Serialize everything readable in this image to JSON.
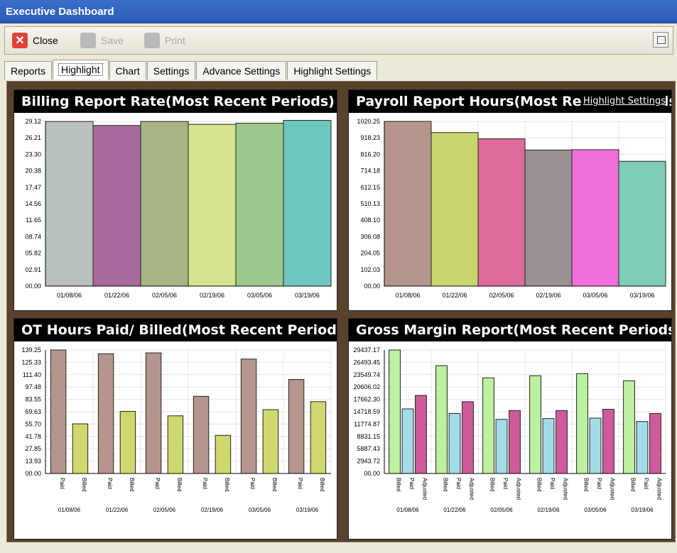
{
  "window": {
    "title": "Executive Dashboard"
  },
  "toolbar": {
    "close_label": "Close",
    "save_label": "Save",
    "print_label": "Print",
    "icons": {
      "close": "close-icon",
      "save": "save-icon",
      "print": "print-icon",
      "restore": "restore-window-icon"
    }
  },
  "tabs": [
    {
      "label": "Reports",
      "active": false
    },
    {
      "label": "Highlight",
      "active": true
    },
    {
      "label": "Chart",
      "active": false
    },
    {
      "label": "Settings",
      "active": false
    },
    {
      "label": "Advance Settings",
      "active": false
    },
    {
      "label": "Highlight Settings",
      "active": false
    }
  ],
  "highlight_link": "Highlight Settings",
  "colors": {
    "panel_bg": "#59412c",
    "title_bg": "#000000"
  },
  "chart_data": [
    {
      "type": "bar",
      "title": "Billing Report Rate(Most Recent Periods)",
      "categories": [
        "01/08/06",
        "01/22/06",
        "02/05/06",
        "02/19/06",
        "03/05/06",
        "03/19/06"
      ],
      "values": [
        29.1,
        28.4,
        29.1,
        28.6,
        28.8,
        29.3
      ],
      "yticks": [
        "00.00",
        "02.91",
        "05.82",
        "08.74",
        "11.65",
        "14.56",
        "17.47",
        "20.38",
        "23.30",
        "26.21",
        "29.12"
      ],
      "ylim": [
        0,
        29.12
      ],
      "colors": [
        "#b9c1be",
        "#a8699c",
        "#a6b582",
        "#d3e48c",
        "#9cc88c",
        "#6ec7bf"
      ],
      "grid": true
    },
    {
      "type": "bar",
      "title": "Payroll Report Hours(Most Recent Periods)",
      "categories": [
        "01/08/06",
        "01/22/06",
        "02/05/06",
        "02/19/06",
        "03/05/06",
        "03/19/06"
      ],
      "values": [
        1020.25,
        951.0,
        912.0,
        843.0,
        845.0,
        773.0
      ],
      "yticks": [
        "00.00",
        "102.03",
        "204.05",
        "306.08",
        "408.10",
        "510.13",
        "612.15",
        "714.18",
        "816.20",
        "918.23",
        "1020.25"
      ],
      "ylim": [
        0,
        1020.25
      ],
      "colors": [
        "#b4968e",
        "#c9d66d",
        "#dd6b9b",
        "#9b8f96",
        "#f16fd9",
        "#7ecdb6"
      ],
      "grid": true
    },
    {
      "type": "bar",
      "title": "OT Hours Paid/ Billed(Most Recent Periods)",
      "categories": [
        "01/08/06",
        "01/22/06",
        "02/05/06",
        "02/19/06",
        "03/05/06",
        "03/19/06"
      ],
      "series": [
        {
          "name": "Paid",
          "values": [
            139.25,
            135.0,
            136.0,
            87.0,
            129.0,
            106.0
          ],
          "color": "#b4968e"
        },
        {
          "name": "Billed",
          "values": [
            56.0,
            70.0,
            65.0,
            43.0,
            72.0,
            81.0
          ],
          "color": "#cfd86f"
        }
      ],
      "yticks": [
        "00.00",
        "13.93",
        "27.85",
        "41.78",
        "55.70",
        "69.63",
        "83.55",
        "97.48",
        "111.40",
        "125.33",
        "139.25"
      ],
      "ylim": [
        0,
        139.25
      ],
      "grid": true
    },
    {
      "type": "bar",
      "title": "Gross Margin Report(Most Recent Periods)",
      "categories": [
        "01/08/06",
        "01/22/06",
        "02/05/06",
        "02/19/06",
        "03/05/06",
        "03/19/06"
      ],
      "series": [
        {
          "name": "Billed",
          "values": [
            29437.17,
            25700,
            22800,
            23300,
            23800,
            22100
          ],
          "color": "#bdf0a0"
        },
        {
          "name": "Paid",
          "values": [
            15400,
            14300,
            12900,
            13100,
            13200,
            12400
          ],
          "color": "#a4dbe9"
        },
        {
          "name": "Adjusted",
          "values": [
            18600,
            17100,
            15000,
            15000,
            15300,
            14300
          ],
          "color": "#cf5b9b"
        }
      ],
      "yticks": [
        "00.00",
        "2943.72",
        "5887.43",
        "8831.15",
        "11774.87",
        "14718.59",
        "17662.30",
        "20606.02",
        "23549.74",
        "26493.45",
        "29437.17"
      ],
      "ylim": [
        0,
        29437.17
      ],
      "grid": true
    }
  ]
}
